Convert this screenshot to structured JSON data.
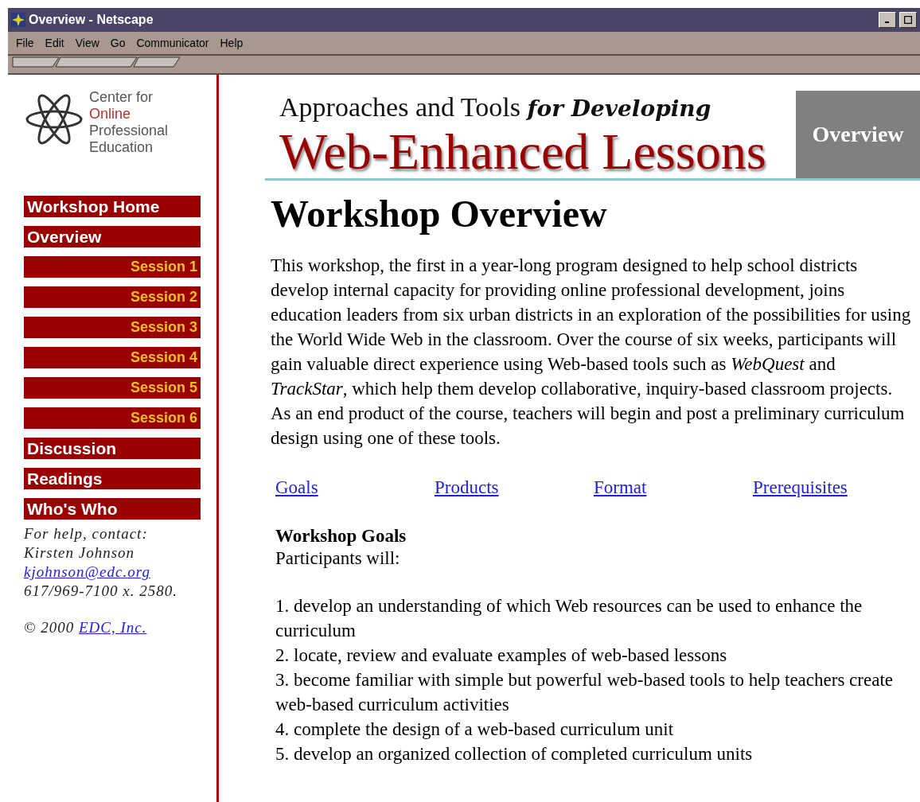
{
  "window": {
    "title": "Overview - Netscape"
  },
  "menu": [
    "File",
    "Edit",
    "View",
    "Go",
    "Communicator",
    "Help"
  ],
  "sidebar": {
    "logo_lines": [
      {
        "text": "Center for",
        "kind": "plain"
      },
      {
        "text": "Online",
        "kind": "accent"
      },
      {
        "text": "Professional",
        "kind": "plain"
      },
      {
        "text": "Education",
        "kind": "plain"
      }
    ],
    "items": [
      {
        "label": "Workshop Home",
        "kind": "main"
      },
      {
        "label": "Overview",
        "kind": "main"
      },
      {
        "label": "Session 1",
        "kind": "session"
      },
      {
        "label": "Session 2",
        "kind": "session"
      },
      {
        "label": "Session 3",
        "kind": "session"
      },
      {
        "label": "Session 4",
        "kind": "session"
      },
      {
        "label": "Session 5",
        "kind": "session"
      },
      {
        "label": "Session 6",
        "kind": "session"
      },
      {
        "label": "Discussion",
        "kind": "main"
      },
      {
        "label": "Readings",
        "kind": "main"
      },
      {
        "label": "Who's Who",
        "kind": "main"
      }
    ],
    "help": "For help, contact:",
    "contact": "Kirsten Johnson",
    "email": "kjohnson@edc.org",
    "phone": "617/969-7100 x. 2580.",
    "copyright": "© 2000",
    "company": "EDC, Inc."
  },
  "banner": {
    "line1": "Approaches and Tools",
    "script": "for Developing",
    "title": "Web-Enhanced Lessons",
    "tag": "Overview"
  },
  "heading": "Workshop Overview",
  "intro": "This workshop, the first in a year-long program designed to help school districts develop internal capacity for providing online professional development,  joins education leaders from six urban districts in an exploration of the possibilities for using the World Wide Web in the classroom.  Over the course of six weeks, participants will gain valuable direct experience using Web-based tools such as *WebQuest* and *TrackStar*, which help them develop collaborative, inquiry-based classroom projects.  As an end product of the course, teachers will begin and post a preliminary curriculum design using one of these tools.",
  "links": [
    "Goals",
    "Products",
    "Format",
    "Prerequisites"
  ],
  "goals": {
    "title": "Workshop Goals",
    "lead": "Participants will:",
    "items": [
      "1.  develop an understanding of which Web resources can be used to enhance the curriculum",
      "2.  locate, review and evaluate examples of web-based lessons",
      "3.  become familiar with simple but powerful web-based  tools to help teachers create web-based curriculum activities",
      "4.  complete the design of a web-based curriculum unit",
      "5.  develop an organized collection of completed curriculum units"
    ]
  }
}
